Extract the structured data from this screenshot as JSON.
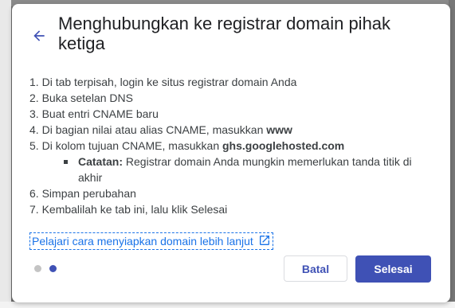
{
  "dialog": {
    "title": "Menghubungkan ke registrar domain pihak ketiga",
    "steps": [
      {
        "num": "1.",
        "text": "Di tab terpisah, login ke situs registrar domain Anda"
      },
      {
        "num": "2.",
        "text": "Buka setelan DNS"
      },
      {
        "num": "3.",
        "text": "Buat entri CNAME baru"
      },
      {
        "num": "4.",
        "text": "Di bagian nilai atau alias CNAME, masukkan ",
        "bold": "www"
      },
      {
        "num": "5.",
        "text": "Di kolom tujuan CNAME, masukkan ",
        "bold": "ghs.googlehosted.com"
      },
      {
        "num": "6.",
        "text": "Simpan perubahan"
      },
      {
        "num": "7.",
        "text": "Kembalilah ke tab ini, lalu klik Selesai"
      }
    ],
    "note": {
      "label": "Catatan:",
      "text": " Registrar domain Anda mungkin memerlukan tanda titik di akhir"
    },
    "learn_link": "Pelajari cara menyiapkan domain lebih lanjut",
    "cancel_label": "Batal",
    "done_label": "Selesai",
    "pagination": {
      "current": 2,
      "total": 2
    }
  },
  "colors": {
    "accent": "#3f51b5",
    "link": "#1a73e8",
    "text": "#3c4043"
  },
  "icons": {
    "back": "arrow-back-icon",
    "external": "open-in-new-icon"
  }
}
